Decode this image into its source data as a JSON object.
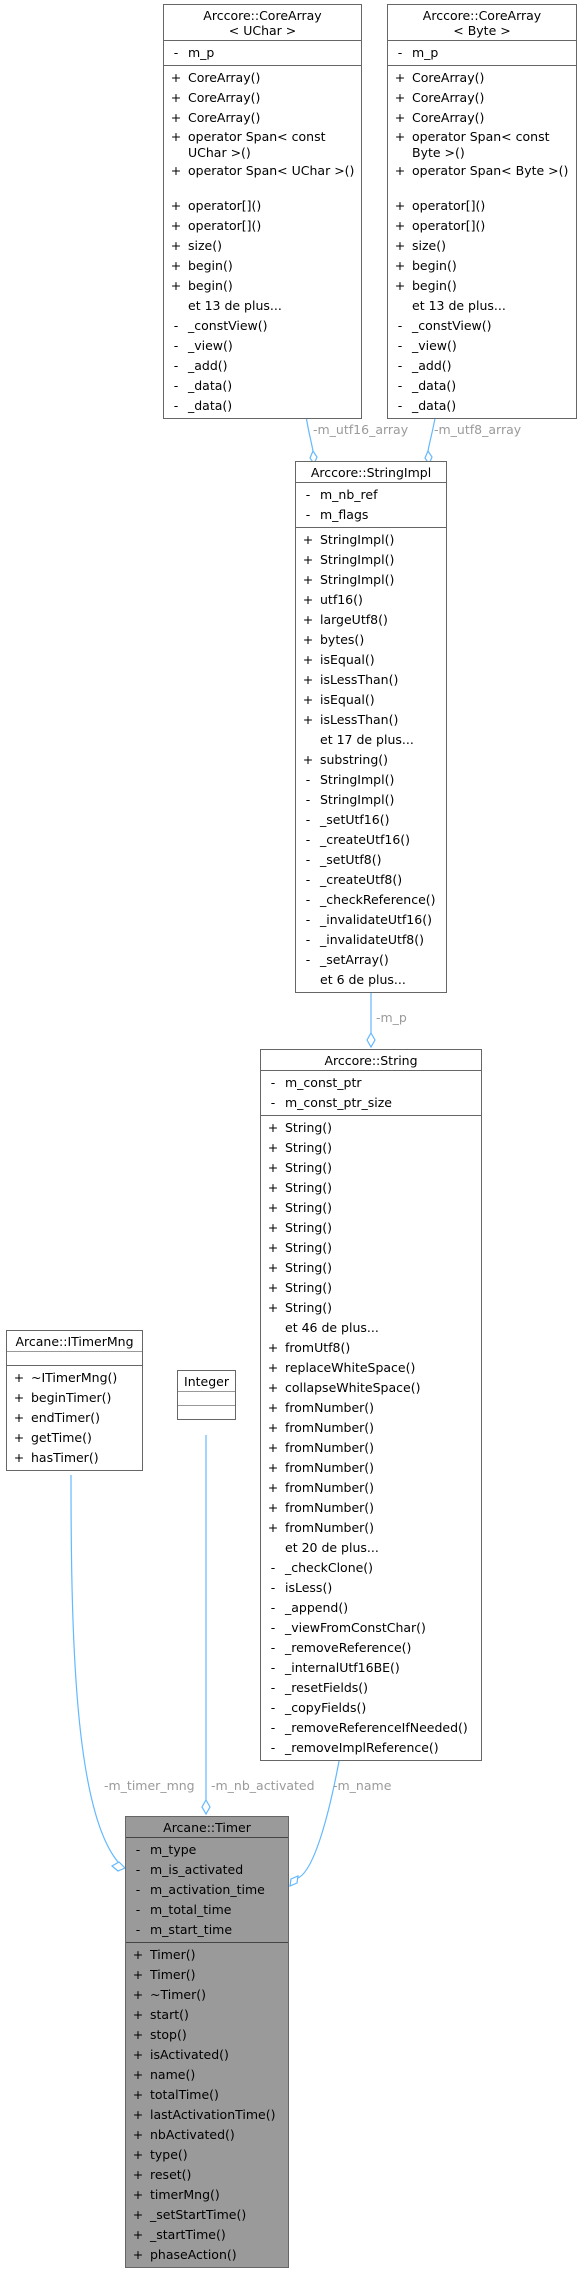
{
  "classes": {
    "core_uchar": {
      "title_lines": [
        "Arccore::CoreArray",
        "< UChar >"
      ],
      "attributes": [
        [
          "-",
          "m_p"
        ]
      ],
      "methods": [
        [
          "+",
          "CoreArray()"
        ],
        [
          "+",
          "CoreArray()"
        ],
        [
          "+",
          "CoreArray()"
        ],
        [
          "+",
          "operator Span< const UChar >()"
        ],
        [
          "+",
          "operator Span< UChar >()"
        ],
        [
          "+",
          "operator[]()"
        ],
        [
          "+",
          "operator[]()"
        ],
        [
          "+",
          "size()"
        ],
        [
          "+",
          "begin()"
        ],
        [
          "+",
          "begin()"
        ],
        [
          "",
          "et 13 de plus..."
        ],
        [
          "-",
          "_constView()"
        ],
        [
          "-",
          "_view()"
        ],
        [
          "-",
          "_add()"
        ],
        [
          "-",
          "_data()"
        ],
        [
          "-",
          "_data()"
        ]
      ]
    },
    "core_byte": {
      "title_lines": [
        "Arccore::CoreArray",
        "< Byte >"
      ],
      "attributes": [
        [
          "-",
          "m_p"
        ]
      ],
      "methods": [
        [
          "+",
          "CoreArray()"
        ],
        [
          "+",
          "CoreArray()"
        ],
        [
          "+",
          "CoreArray()"
        ],
        [
          "+",
          "operator Span< const Byte >()"
        ],
        [
          "+",
          "operator Span< Byte >()"
        ],
        [
          "+",
          "operator[]()"
        ],
        [
          "+",
          "operator[]()"
        ],
        [
          "+",
          "size()"
        ],
        [
          "+",
          "begin()"
        ],
        [
          "+",
          "begin()"
        ],
        [
          "",
          "et 13 de plus..."
        ],
        [
          "-",
          "_constView()"
        ],
        [
          "-",
          "_view()"
        ],
        [
          "-",
          "_add()"
        ],
        [
          "-",
          "_data()"
        ],
        [
          "-",
          "_data()"
        ]
      ]
    },
    "string_impl": {
      "title_lines": [
        "Arccore::StringImpl"
      ],
      "attributes": [
        [
          "-",
          "m_nb_ref"
        ],
        [
          "-",
          "m_flags"
        ]
      ],
      "methods": [
        [
          "+",
          "StringImpl()"
        ],
        [
          "+",
          "StringImpl()"
        ],
        [
          "+",
          "StringImpl()"
        ],
        [
          "+",
          "utf16()"
        ],
        [
          "+",
          "largeUtf8()"
        ],
        [
          "+",
          "bytes()"
        ],
        [
          "+",
          "isEqual()"
        ],
        [
          "+",
          "isLessThan()"
        ],
        [
          "+",
          "isEqual()"
        ],
        [
          "+",
          "isLessThan()"
        ],
        [
          "",
          "et 17 de plus..."
        ],
        [
          "+",
          "substring()"
        ],
        [
          "-",
          "StringImpl()"
        ],
        [
          "-",
          "StringImpl()"
        ],
        [
          "-",
          "_setUtf16()"
        ],
        [
          "-",
          "_createUtf16()"
        ],
        [
          "-",
          "_setUtf8()"
        ],
        [
          "-",
          "_createUtf8()"
        ],
        [
          "-",
          "_checkReference()"
        ],
        [
          "-",
          "_invalidateUtf16()"
        ],
        [
          "-",
          "_invalidateUtf8()"
        ],
        [
          "-",
          "_setArray()"
        ],
        [
          "",
          "et 6 de plus..."
        ]
      ]
    },
    "string": {
      "title_lines": [
        "Arccore::String"
      ],
      "attributes": [
        [
          "-",
          "m_const_ptr"
        ],
        [
          "-",
          "m_const_ptr_size"
        ]
      ],
      "methods": [
        [
          "+",
          "String()"
        ],
        [
          "+",
          "String()"
        ],
        [
          "+",
          "String()"
        ],
        [
          "+",
          "String()"
        ],
        [
          "+",
          "String()"
        ],
        [
          "+",
          "String()"
        ],
        [
          "+",
          "String()"
        ],
        [
          "+",
          "String()"
        ],
        [
          "+",
          "String()"
        ],
        [
          "+",
          "String()"
        ],
        [
          "",
          "et 46 de plus..."
        ],
        [
          "+",
          "fromUtf8()"
        ],
        [
          "+",
          "replaceWhiteSpace()"
        ],
        [
          "+",
          "collapseWhiteSpace()"
        ],
        [
          "+",
          "fromNumber()"
        ],
        [
          "+",
          "fromNumber()"
        ],
        [
          "+",
          "fromNumber()"
        ],
        [
          "+",
          "fromNumber()"
        ],
        [
          "+",
          "fromNumber()"
        ],
        [
          "+",
          "fromNumber()"
        ],
        [
          "+",
          "fromNumber()"
        ],
        [
          "",
          "et 20 de plus..."
        ],
        [
          "-",
          "_checkClone()"
        ],
        [
          "-",
          "isLess()"
        ],
        [
          "-",
          "_append()"
        ],
        [
          "-",
          "_viewFromConstChar()"
        ],
        [
          "-",
          "_removeReference()"
        ],
        [
          "-",
          "_internalUtf16BE()"
        ],
        [
          "-",
          "_resetFields()"
        ],
        [
          "-",
          "_copyFields()"
        ],
        [
          "-",
          "_removeReferenceIfNeeded()"
        ],
        [
          "-",
          "_removeImplReference()"
        ]
      ]
    },
    "itimermng": {
      "title_lines": [
        "Arcane::ITimerMng"
      ],
      "attributes": [],
      "methods": [
        [
          "+",
          "~ITimerMng()"
        ],
        [
          "+",
          "beginTimer()"
        ],
        [
          "+",
          "endTimer()"
        ],
        [
          "+",
          "getTime()"
        ],
        [
          "+",
          "hasTimer()"
        ]
      ]
    },
    "integer": {
      "title_lines": [
        "Integer"
      ],
      "attributes": [],
      "methods": []
    },
    "timer": {
      "title_lines": [
        "Arcane::Timer"
      ],
      "attributes": [
        [
          "-",
          "m_type"
        ],
        [
          "-",
          "m_is_activated"
        ],
        [
          "-",
          "m_activation_time"
        ],
        [
          "-",
          "m_total_time"
        ],
        [
          "-",
          "m_start_time"
        ]
      ],
      "methods": [
        [
          "+",
          "Timer()"
        ],
        [
          "+",
          "Timer()"
        ],
        [
          "+",
          "~Timer()"
        ],
        [
          "+",
          "start()"
        ],
        [
          "+",
          "stop()"
        ],
        [
          "+",
          "isActivated()"
        ],
        [
          "+",
          "name()"
        ],
        [
          "+",
          "totalTime()"
        ],
        [
          "+",
          "lastActivationTime()"
        ],
        [
          "+",
          "nbActivated()"
        ],
        [
          "+",
          "type()"
        ],
        [
          "+",
          "reset()"
        ],
        [
          "+",
          "timerMng()"
        ],
        [
          "+",
          "_setStartTime()"
        ],
        [
          "+",
          "_startTime()"
        ],
        [
          "+",
          "phaseAction()"
        ]
      ]
    }
  },
  "edges": {
    "utf16": "-m_utf16_array",
    "utf8": "-m_utf8_array",
    "mp": "-m_p",
    "timer_mng": "-m_timer_mng",
    "nb_activated": "-m_nb_activated",
    "name": "-m_name"
  },
  "colors": {
    "edge": "#63b8ff",
    "edge_label": "#9a9a9a",
    "border": "#666666",
    "highlight_fill": "#9a9a9a"
  }
}
